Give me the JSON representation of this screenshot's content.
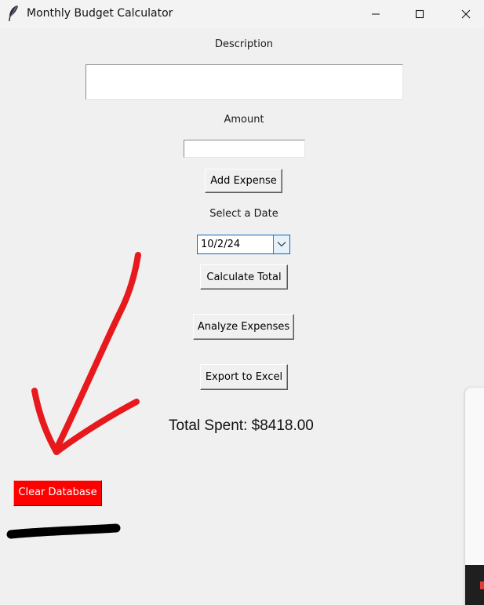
{
  "window": {
    "title": "Monthly Budget Calculator",
    "controls": [
      "minimize",
      "maximize",
      "close"
    ]
  },
  "form": {
    "description_label": "Description",
    "description_value": "",
    "amount_label": "Amount",
    "amount_value": "",
    "add_expense_label": "Add Expense",
    "select_date_label": "Select a Date",
    "date_value": "10/2/24",
    "calculate_total_label": "Calculate Total",
    "analyze_expenses_label": "Analyze Expenses",
    "export_excel_label": "Export to Excel",
    "total_spent_text": "Total Spent: $8418.00",
    "clear_database_label": "Clear Database"
  },
  "annotations": {
    "arrow_color": "#e8191c",
    "underline_color": "#000000"
  },
  "colors": {
    "clear_button_bg": "#ff0000",
    "window_bg": "#f0f0f0",
    "combo_border": "#0b66c2"
  },
  "icons": {
    "app": "feather-icon",
    "minimize": "minimize-icon",
    "maximize": "maximize-icon",
    "close": "close-icon",
    "dropdown": "chevron-down-icon"
  }
}
